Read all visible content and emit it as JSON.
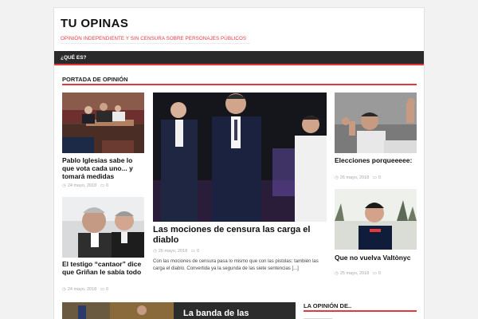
{
  "site": {
    "title": "TU OPINAS",
    "description": "OPINIÓN INDEPENDIENTE Y SIN CENSURA SOBRE PERSONAJES PÚBLICOS"
  },
  "nav": {
    "items": [
      {
        "label": "¿QUÉ ES?"
      }
    ]
  },
  "section": {
    "title": "PORTADA DE OPINIÓN"
  },
  "posts": [
    {
      "title": "Pablo Iglesias sabe lo que vota cada uno... y tomará medidas",
      "date": "24 mayo, 2018",
      "comments": "0"
    },
    {
      "title": "El testigo “cantaor” dice que Griñan le sabía todo",
      "date": "24 mayo, 2018",
      "comments": "0"
    },
    {
      "title": "Las mociones de censura las carga el diablo",
      "date": "26 mayo, 2018",
      "comments": "0",
      "excerpt": "Con las mociones de censura pasa lo mismo que con las pistolas: también las carga el diablo. Convertida ya la segunda de las siete sentencias [...]"
    },
    {
      "title": "Elecciones porqueeeee:",
      "date": "26 mayo, 2018",
      "comments": "0"
    },
    {
      "title": "Que no vuelva Valtònyc",
      "date": "25 mayo, 2018",
      "comments": "0"
    }
  ],
  "bottom_feature": {
    "title": "La banda de las"
  },
  "sidebar": {
    "title": "LA OPINIÓN DE.."
  },
  "icons": {
    "clock": "clock-icon",
    "comment": "comment-icon"
  },
  "colors": {
    "accent": "#e4393c",
    "nav_bg": "#2a2a2a"
  }
}
